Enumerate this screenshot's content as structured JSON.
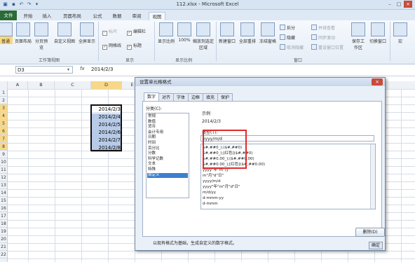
{
  "window": {
    "title": "112.xlsx - Microsoft Excel"
  },
  "tabs": [
    "文件",
    "开始",
    "插入",
    "页面布局",
    "公式",
    "数据",
    "审阅",
    "视图"
  ],
  "ribbon": {
    "workbook_views": {
      "group_label": "工作簿视图",
      "buttons": [
        "普通",
        "页面布局",
        "分页预览",
        "自定义视图",
        "全屏显示"
      ]
    },
    "show": {
      "group_label": "显示",
      "checkboxes": [
        {
          "label": "标尺",
          "checked": true,
          "disabled": true
        },
        {
          "label": "编辑栏",
          "checked": true,
          "disabled": false
        },
        {
          "label": "网格线",
          "checked": true,
          "disabled": false
        },
        {
          "label": "标题",
          "checked": true,
          "disabled": false
        }
      ]
    },
    "zoom": {
      "group_label": "显示比例",
      "buttons": [
        "显示比例",
        "100%",
        "缩放到选定区域"
      ]
    },
    "window_group": {
      "group_label": "窗口",
      "buttons": [
        "新建窗口",
        "全部重排",
        "冻结窗格"
      ],
      "small_buttons": [
        "拆分",
        "隐藏",
        "取消隐藏",
        "并排查看",
        "同步滚动",
        "重设窗口位置"
      ]
    },
    "extra": {
      "buttons": [
        "保存工作区",
        "切换窗口",
        "宏"
      ]
    }
  },
  "formula_bar": {
    "name_box": "D3",
    "fx": "fx",
    "content": "2014/2/3"
  },
  "columns": [
    "A",
    "B",
    "C",
    "D",
    "E"
  ],
  "rows": [
    "1",
    "2",
    "3",
    "4",
    "5",
    "6",
    "7",
    "8",
    "9",
    "10",
    "11",
    "12",
    "13",
    "14",
    "15",
    "16",
    "17",
    "18",
    "19",
    "20",
    "21",
    "22"
  ],
  "cells": [
    {
      "value": "2014/2/3",
      "highlight": false
    },
    {
      "value": "2014/2/4",
      "highlight": true
    },
    {
      "value": "2014/2/5",
      "highlight": true
    },
    {
      "value": "2014/2/6",
      "highlight": true
    },
    {
      "value": "2014/2/7",
      "highlight": true
    },
    {
      "value": "2014/2/8",
      "highlight": true
    }
  ],
  "dialog": {
    "title": "设置单元格格式",
    "tabs": [
      "数字",
      "对齐",
      "字体",
      "边框",
      "填充",
      "保护"
    ],
    "category_label": "分类(C):",
    "categories": [
      "常规",
      "数值",
      "货币",
      "会计专用",
      "日期",
      "时间",
      "百分比",
      "分数",
      "科学记数",
      "文本",
      "特殊",
      "自定义"
    ],
    "selected_category": "自定义",
    "sample_label": "示例",
    "sample_value": "2014/2/3",
    "type_label": "类型(T):",
    "type_value": "yyyy/m/d",
    "formats": [
      "$#,##0_);($#,##0)",
      "$#,##0_);[红色]($#,##0)",
      "$#,##0.00_);($#,##0.00)",
      "$#,##0.00_);[红色]($#,##0.00)",
      "yyyy\"年\"m\"月\"",
      "m\"月\"d\"日\"",
      "yyyy/m/d",
      "yyyy\"年\"m\"月\"d\"日\"",
      "m/d/yy",
      "d-mmm-yy",
      "d-mmm"
    ],
    "delete_label": "删除(D)",
    "description": "以现有格式为基础，生成自定义的数字格式。",
    "ok_label": "确定"
  }
}
